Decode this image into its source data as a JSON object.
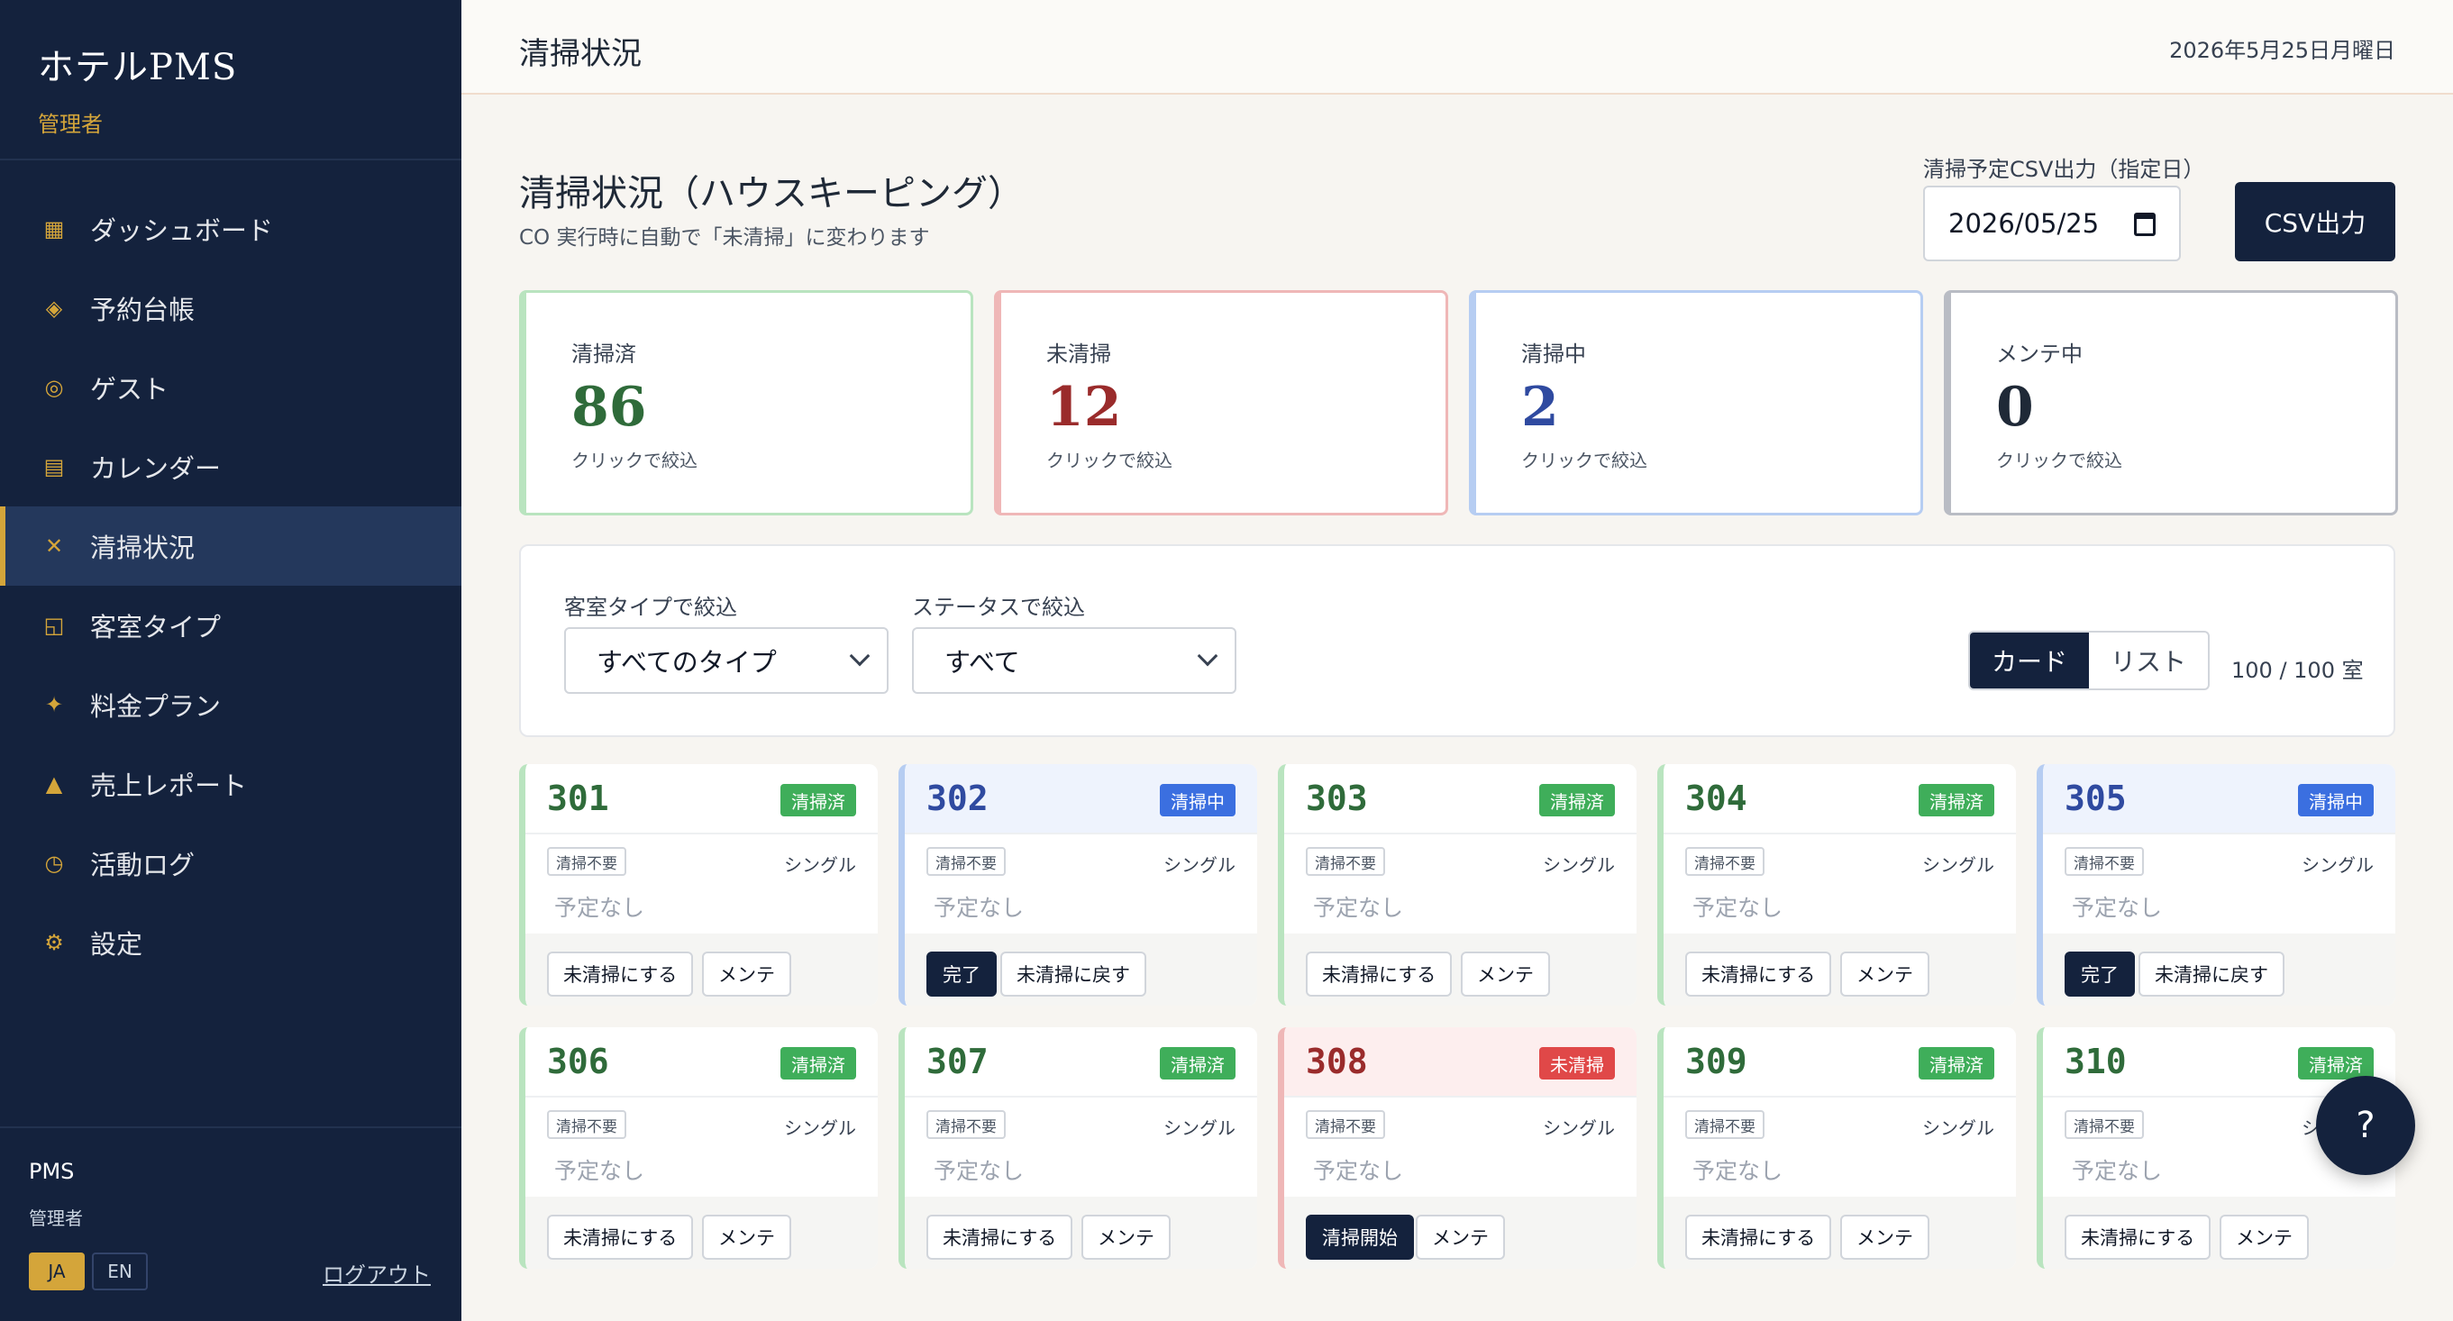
{
  "sidebar": {
    "brand": "ホテルPMS",
    "role": "管理者",
    "items": [
      {
        "label": "ダッシュボード",
        "icon": "grid-icon",
        "glyph": "▦"
      },
      {
        "label": "予約台帳",
        "icon": "diamond-icon",
        "glyph": "◈"
      },
      {
        "label": "ゲスト",
        "icon": "circle-icon",
        "glyph": "◎"
      },
      {
        "label": "カレンダー",
        "icon": "calendar-icon",
        "glyph": "▤"
      },
      {
        "label": "清掃状況",
        "icon": "cross-icon",
        "glyph": "✕"
      },
      {
        "label": "客室タイプ",
        "icon": "room-icon",
        "glyph": "◱"
      },
      {
        "label": "料金プラン",
        "icon": "sparkle-icon",
        "glyph": "✦"
      },
      {
        "label": "売上レポート",
        "icon": "triangle-icon",
        "glyph": "▲"
      },
      {
        "label": "活動ログ",
        "icon": "clock-icon",
        "glyph": "◷"
      },
      {
        "label": "設定",
        "icon": "gear-icon",
        "glyph": "⚙"
      }
    ],
    "active_index": 4,
    "footer": {
      "app": "PMS",
      "role": "管理者",
      "lang_ja": "JA",
      "lang_en": "EN",
      "logout": "ログアウト"
    }
  },
  "header": {
    "title": "清掃状況",
    "date": "2026年5月25日月曜日"
  },
  "main": {
    "title": "清掃状況（ハウスキーピング）",
    "subtitle": "CO 実行時に自動で「未清掃」に変わります",
    "csv": {
      "label": "清掃予定CSV出力（指定日）",
      "date": "2026/05/25",
      "button": "CSV出力"
    },
    "stats": [
      {
        "label": "清掃済",
        "value": "86",
        "hint": "クリックで絞込",
        "color": "#2f6b3a",
        "border": "#b9e4bf"
      },
      {
        "label": "未清掃",
        "value": "12",
        "hint": "クリックで絞込",
        "color": "#9a2b2b",
        "border": "#efb7b7"
      },
      {
        "label": "清掃中",
        "value": "2",
        "hint": "クリックで絞込",
        "color": "#2f4aa0",
        "border": "#b6cdf2"
      },
      {
        "label": "メンテ中",
        "value": "0",
        "hint": "クリックで絞込",
        "color": "#1f2937",
        "border": "#b9bcc4"
      }
    ],
    "filters": {
      "type_label": "客室タイプで絞込",
      "type_value": "すべてのタイプ",
      "status_label": "ステータスで絞込",
      "status_value": "すべて",
      "view_card": "カード",
      "view_list": "リスト",
      "count": "100 / 100 室"
    },
    "rooms": [
      {
        "no": "301",
        "status": "清掃済",
        "tag": "清掃不要",
        "type": "シングル",
        "plan": "予定なし",
        "actions": [
          "未清掃にする",
          "メンテ"
        ],
        "dark": -1
      },
      {
        "no": "302",
        "status": "清掃中",
        "tag": "清掃不要",
        "type": "シングル",
        "plan": "予定なし",
        "actions": [
          "完了",
          "未清掃に戻す"
        ],
        "dark": 0
      },
      {
        "no": "303",
        "status": "清掃済",
        "tag": "清掃不要",
        "type": "シングル",
        "plan": "予定なし",
        "actions": [
          "未清掃にする",
          "メンテ"
        ],
        "dark": -1
      },
      {
        "no": "304",
        "status": "清掃済",
        "tag": "清掃不要",
        "type": "シングル",
        "plan": "予定なし",
        "actions": [
          "未清掃にする",
          "メンテ"
        ],
        "dark": -1
      },
      {
        "no": "305",
        "status": "清掃中",
        "tag": "清掃不要",
        "type": "シングル",
        "plan": "予定なし",
        "actions": [
          "完了",
          "未清掃に戻す"
        ],
        "dark": 0
      },
      {
        "no": "306",
        "status": "清掃済",
        "tag": "清掃不要",
        "type": "シングル",
        "plan": "予定なし",
        "actions": [
          "未清掃にする",
          "メンテ"
        ],
        "dark": -1
      },
      {
        "no": "307",
        "status": "清掃済",
        "tag": "清掃不要",
        "type": "シングル",
        "plan": "予定なし",
        "actions": [
          "未清掃にする",
          "メンテ"
        ],
        "dark": -1
      },
      {
        "no": "308",
        "status": "未清掃",
        "tag": "清掃不要",
        "type": "シングル",
        "plan": "予定なし",
        "actions": [
          "清掃開始",
          "メンテ"
        ],
        "dark": 0
      },
      {
        "no": "309",
        "status": "清掃済",
        "tag": "清掃不要",
        "type": "シングル",
        "plan": "予定なし",
        "actions": [
          "未清掃にする",
          "メンテ"
        ],
        "dark": -1
      },
      {
        "no": "310",
        "status": "清掃済",
        "tag": "清掃不要",
        "type": "シングル",
        "plan": "予定なし",
        "actions": [
          "未清掃にする",
          "メンテ"
        ],
        "dark": -1
      }
    ]
  },
  "status_colors": {
    "清掃済": {
      "accent": "#b9e4bf",
      "badge": "#3fae5a",
      "text": "#2f6b3a",
      "head": "#ffffff"
    },
    "清掃中": {
      "accent": "#b6cdf2",
      "badge": "#3b6fe0",
      "text": "#2f4aa0",
      "head": "#eef3fd"
    },
    "未清掃": {
      "accent": "#efb7b7",
      "badge": "#e04848",
      "text": "#9a2b2b",
      "head": "#fdeeee"
    }
  },
  "help_button": "?"
}
